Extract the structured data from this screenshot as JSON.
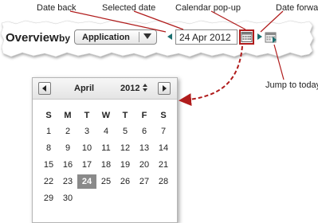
{
  "callouts": {
    "date_back": "Date back",
    "selected_date": "Selected date",
    "calendar_popup": "Calendar pop-up",
    "date_forward": "Date forward",
    "jump_to_today": "Jump to today"
  },
  "toolbar": {
    "title": "Overview",
    "by_label": "by",
    "grouping_value": "Application",
    "date_value": "24 Apr 2012"
  },
  "calendar": {
    "month": "April",
    "year": "2012",
    "weekdays": [
      "S",
      "M",
      "T",
      "W",
      "T",
      "F",
      "S"
    ],
    "weeks": [
      [
        "1",
        "2",
        "3",
        "4",
        "5",
        "6",
        "7"
      ],
      [
        "8",
        "9",
        "10",
        "11",
        "12",
        "13",
        "14"
      ],
      [
        "15",
        "16",
        "17",
        "18",
        "19",
        "20",
        "21"
      ],
      [
        "22",
        "23",
        "24",
        "25",
        "26",
        "27",
        "28"
      ],
      [
        "29",
        "30",
        "",
        "",
        "",
        "",
        ""
      ]
    ],
    "selected_day": "24"
  },
  "colors": {
    "callout_arrow": "#b01b1b",
    "nav_arrow": "#1b6f6f",
    "selected_day_bg": "#8a8a8a"
  },
  "icons": [
    "caret-left-icon",
    "calendar-icon",
    "caret-right-icon",
    "jump-to-today-icon",
    "chevron-down-icon",
    "year-spinner-icon"
  ]
}
